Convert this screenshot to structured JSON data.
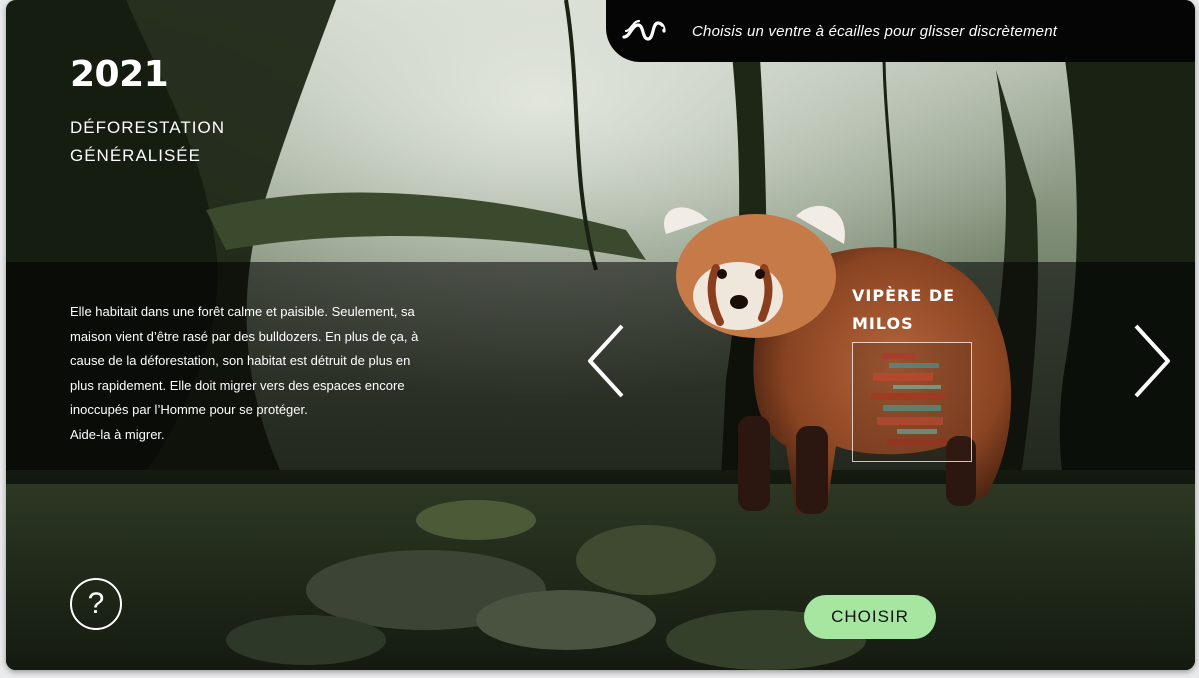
{
  "header": {
    "year": "2021",
    "title_line1": "DÉFORESTATION",
    "title_line2": "GÉNÉRALISÉE"
  },
  "hint": {
    "icon": "snake-icon",
    "text": "Choisis un ventre à écailles pour glisser discrètement"
  },
  "story": {
    "line1": "Elle habitait dans une forêt calme et paisible. Seulement, sa",
    "line2": "maison vient d’être rasé par des bulldozers. En plus de ça, à",
    "line3": "cause de la déforestation, son habitat est détruit de plus en",
    "line4": "plus rapidement. Elle doit migrer vers des espaces encore",
    "line5": "inoccupés par l’Homme pour se protéger.",
    "line6": "Aide-la à migrer."
  },
  "carousel": {
    "prev_icon": "chevron-left-icon",
    "next_icon": "chevron-right-icon",
    "species_line1": "VIPÈRE DE",
    "species_line2": "MILOS"
  },
  "actions": {
    "help_label": "?",
    "choose_label": "CHOISIR"
  },
  "colors": {
    "accent_button": "#a6e6a1",
    "overlay": "#000000",
    "text": "#ffffff"
  }
}
